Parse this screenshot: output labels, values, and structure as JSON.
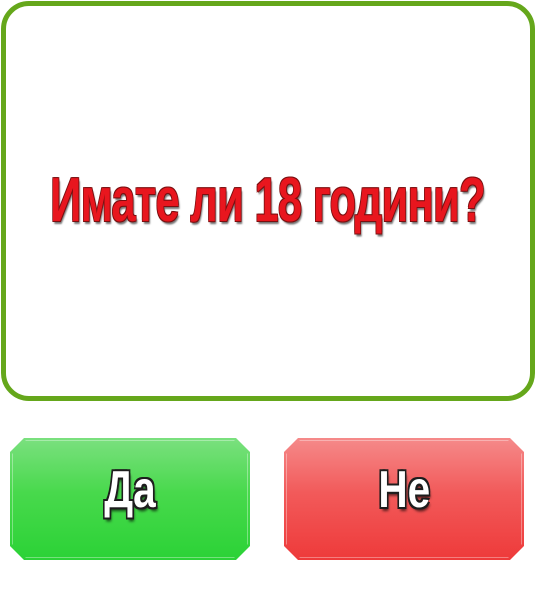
{
  "question": {
    "text": "Имате ли 18 години?"
  },
  "buttons": {
    "yes_label": "Да",
    "no_label": "Не"
  },
  "colors": {
    "panel_border": "#65a71b",
    "question_text": "#e8161e",
    "yes_button": "#2bd236",
    "no_button": "#ee3a3a"
  }
}
